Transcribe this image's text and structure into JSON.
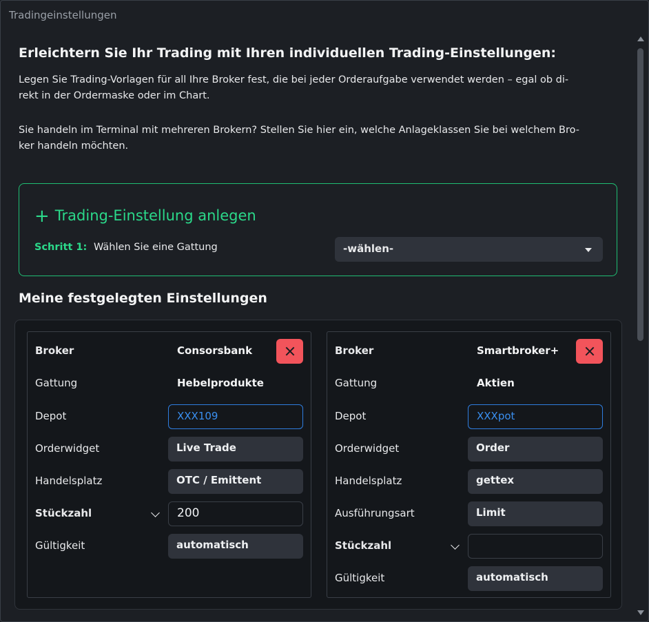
{
  "window": {
    "title": "Tradingeinstellungen"
  },
  "intro": {
    "headline": "Erleichtern Sie Ihr Trading mit Ihren individuellen Trading-Einstellungen:",
    "para1_line1": "Legen Sie Trading-Vorlagen für all Ihre Broker fest, die bei jeder Orderaufgabe verwendet werden – egal ob di-",
    "para1_line2": "rekt in der Ordermaske oder im Chart.",
    "para2_line1": "Sie handeln im Terminal mit mehreren Brokern? Stellen Sie hier ein, welche Anlageklassen Sie bei welchem Bro-",
    "para2_line2": "ker handeln möchten."
  },
  "create": {
    "plus": "+",
    "title": "Trading-Einstellung anlegen",
    "step_label": "Schritt 1:",
    "step_text": "Wählen Sie eine Gattung",
    "select_value": "-wählen-"
  },
  "settings": {
    "title": "Meine festgelegten Einstellungen",
    "cards": [
      {
        "broker_label": "Broker",
        "broker": "Consorsbank",
        "gattung_label": "Gattung",
        "gattung": "Hebelprodukte",
        "depot_label": "Depot",
        "depot": "XXX109",
        "orderwidget_label": "Orderwidget",
        "orderwidget": "Live Trade",
        "handelsplatz_label": "Handelsplatz",
        "handelsplatz": "OTC / Emittent",
        "stueckzahl_label": "Stückzahl",
        "stueckzahl": "200",
        "gueltigkeit_label": "Gültigkeit",
        "gueltigkeit": "automatisch"
      },
      {
        "broker_label": "Broker",
        "broker": "Smartbroker+",
        "gattung_label": "Gattung",
        "gattung": "Aktien",
        "depot_label": "Depot",
        "depot": "XXXpot",
        "orderwidget_label": "Orderwidget",
        "orderwidget": "Order",
        "handelsplatz_label": "Handelsplatz",
        "handelsplatz": "gettex",
        "ausfuehrungsart_label": "Ausführungsart",
        "ausfuehrungsart": "Limit",
        "stueckzahl_label": "Stückzahl",
        "stueckzahl": "",
        "gueltigkeit_label": "Gültigkeit",
        "gueltigkeit": "automatisch"
      }
    ]
  },
  "colors": {
    "accent_green": "#2bd98a",
    "delete_red": "#f2545b",
    "depot_blue": "#3a8ff0"
  }
}
